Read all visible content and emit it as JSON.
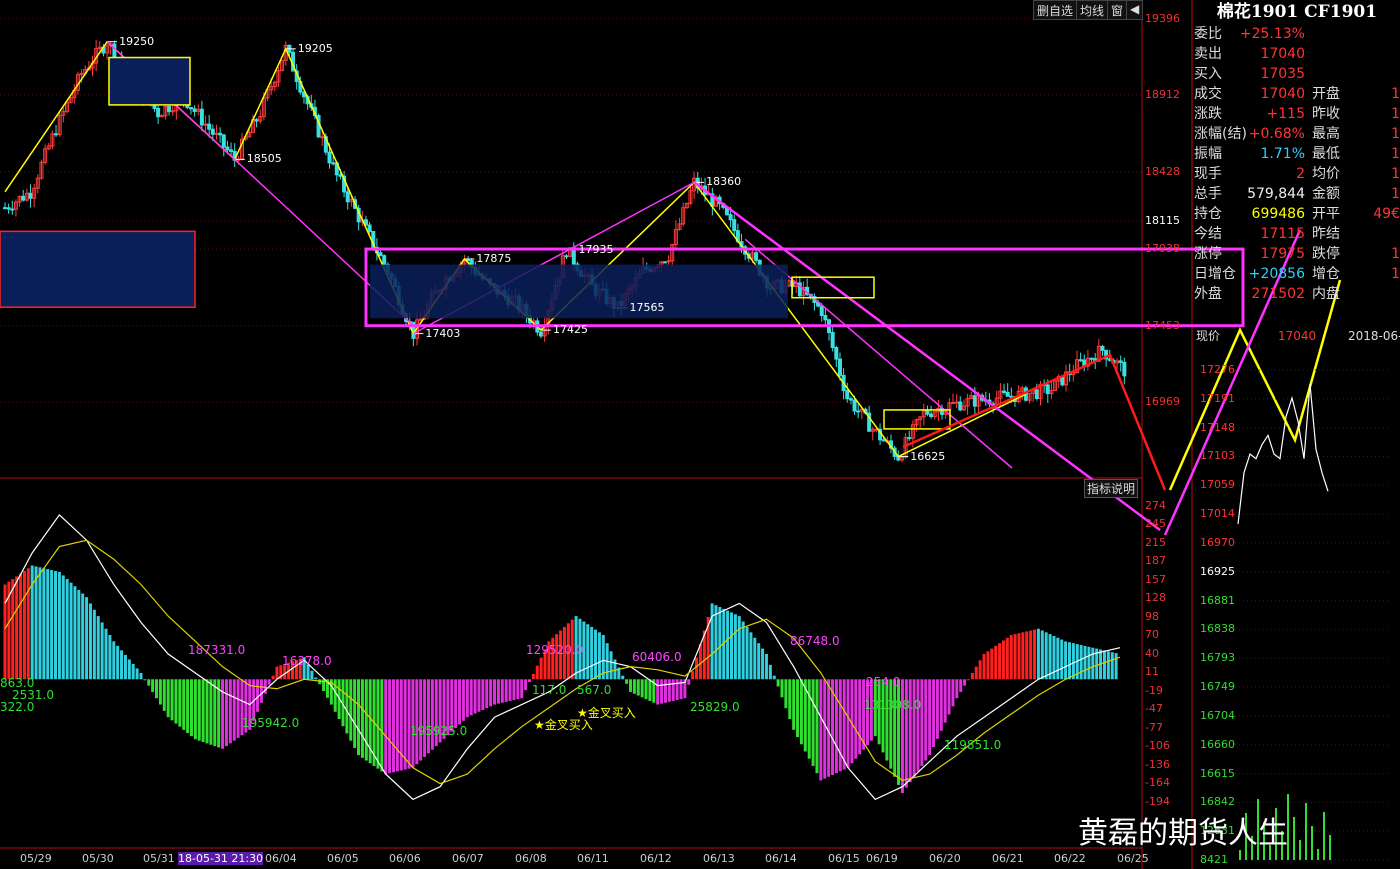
{
  "toolbar": {
    "items": [
      "删自选",
      "均线",
      "窗",
      "◀"
    ]
  },
  "quote": {
    "title": "棉花1901 CF1901",
    "rows": [
      {
        "label": "委比",
        "value": "+25.13%",
        "vcolor": "#ff3333"
      },
      {
        "label": "卖出",
        "value": "17040",
        "vcolor": "#ff3333"
      },
      {
        "label": "买入",
        "value": "17035",
        "vcolor": "#ff3333"
      },
      {
        "label": "成交",
        "value": "17040",
        "vcolor": "#ff3333",
        "label2": "开盘"
      },
      {
        "label": "涨跌",
        "value": "+115",
        "vcolor": "#ff3333",
        "label2": "昨收"
      },
      {
        "label": "涨幅(结)",
        "value": "+0.68%",
        "vcolor": "#ff3333",
        "label2": "最高"
      },
      {
        "label": "振幅",
        "value": "1.71%",
        "vcolor": "#33ccff",
        "label2": "最低"
      },
      {
        "label": "现手",
        "value": "2",
        "vcolor": "#ff3333",
        "label2": "均价"
      },
      {
        "label": "总手",
        "value": "579,844",
        "vcolor": "#eeeeee",
        "label2": "金额"
      },
      {
        "label": "持仓",
        "value": "699486",
        "vcolor": "#ffff00",
        "label2": "开平"
      },
      {
        "label": "今结",
        "value": "17115",
        "vcolor": "#ff3333",
        "label2": "昨结"
      },
      {
        "label": "涨停",
        "value": "17975",
        "vcolor": "#ff3333",
        "label2": "跌停"
      },
      {
        "label": "日增仓",
        "value": "+20856",
        "vcolor": "#33ccff",
        "label2": "增仓"
      },
      {
        "label": "外盘",
        "value": "271502",
        "vcolor": "#ff3333",
        "label2": "内盘"
      }
    ],
    "right_values": [
      "1",
      "1",
      "1",
      "1",
      "1",
      "1",
      "49€",
      "",
      "1",
      "1",
      "",
      "30"
    ],
    "price_label": "现价",
    "price_value": "17040",
    "date_value": "2018-06-2"
  },
  "hint_label": "指标说明",
  "watermark": "黄磊的期货人生",
  "chart_data": [
    {
      "type": "candlestick",
      "title": "",
      "y_ticks": [
        19396,
        18912,
        18428,
        18115,
        17938,
        17453,
        16969
      ],
      "ylim": [
        16540,
        19400
      ],
      "x_ticks": [
        "05/29",
        "05/30",
        "05/31",
        "18-05-31 21:30",
        "06/04",
        "06/05",
        "06/06",
        "06/07",
        "06/08",
        "06/11",
        "06/12",
        "06/13",
        "06/14",
        "06/15",
        "06/19",
        "06/20",
        "06/21",
        "06/22",
        "06/25"
      ],
      "annotations": [
        {
          "text": "19250",
          "value": 19250
        },
        {
          "text": "19205",
          "value": 19205
        },
        {
          "text": "18505",
          "value": 18505
        },
        {
          "text": "17875",
          "value": 17875
        },
        {
          "text": "17935",
          "value": 17935
        },
        {
          "text": "17565",
          "value": 17565
        },
        {
          "text": "17403",
          "value": 17403
        },
        {
          "text": "17425",
          "value": 17425
        },
        {
          "text": "18360",
          "value": 18360
        },
        {
          "text": "16625",
          "value": 16625
        }
      ],
      "price_path": [
        18200,
        18300,
        18700,
        19050,
        19250,
        19000,
        18800,
        18900,
        18700,
        18505,
        18800,
        19205,
        18800,
        18400,
        18100,
        17800,
        17403,
        17700,
        17875,
        17700,
        17600,
        17425,
        17935,
        17700,
        17565,
        17800,
        17900,
        18360,
        18200,
        17950,
        17700,
        17700,
        17550,
        17000,
        16800,
        16625,
        16900,
        16950,
        16980,
        17000,
        17020,
        17050,
        17200,
        17300,
        17150
      ]
    },
    {
      "type": "bar",
      "title": "",
      "y_ticks": [
        274,
        245,
        215,
        187,
        157,
        128,
        98,
        70,
        40,
        11,
        -19,
        -47,
        -77,
        -106,
        -136,
        -164,
        -194
      ],
      "ylim": [
        -210,
        290
      ],
      "labels": [
        "187331.0",
        "16378.0",
        "129520.0",
        "60406.0",
        "86748.0",
        "195942.0",
        "195925.0",
        "117.0",
        "567.0",
        "25829.0",
        "131308.0",
        "119851.0",
        "2531.0",
        "322.0",
        "863.0",
        "254.0"
      ],
      "annotation_signals": [
        "金叉买入",
        "金叉买入"
      ],
      "macd": [
        150,
        180,
        170,
        130,
        60,
        10,
        -60,
        -95,
        -110,
        -80,
        20,
        35,
        -40,
        -120,
        -150,
        -140,
        -100,
        -60,
        -40,
        -30,
        60,
        100,
        70,
        -20,
        -40,
        -30,
        120,
        100,
        40,
        -80,
        -160,
        -140,
        -90,
        -180,
        -120,
        -30,
        40,
        70,
        80,
        60,
        50,
        40
      ],
      "dif": [
        120,
        200,
        260,
        220,
        150,
        90,
        40,
        10,
        -20,
        -40,
        0,
        30,
        -10,
        -80,
        -150,
        -190,
        -170,
        -110,
        -60,
        -40,
        -20,
        10,
        30,
        20,
        -10,
        -5,
        100,
        120,
        90,
        20,
        -60,
        -140,
        -190,
        -170,
        -130,
        -90,
        -60,
        -30,
        0,
        20,
        40,
        50
      ],
      "dea": [
        80,
        150,
        210,
        220,
        190,
        150,
        100,
        60,
        20,
        -10,
        -15,
        0,
        -5,
        -40,
        -90,
        -140,
        -165,
        -150,
        -110,
        -75,
        -45,
        -15,
        10,
        20,
        15,
        5,
        40,
        80,
        95,
        65,
        10,
        -60,
        -130,
        -160,
        -150,
        -120,
        -85,
        -55,
        -25,
        0,
        20,
        35
      ]
    },
    {
      "type": "line",
      "title": "",
      "y_ticks": [
        17276,
        17191,
        17148,
        17103,
        17059,
        17014,
        16970,
        16925,
        16881,
        16838,
        16793,
        16749,
        16704,
        16660,
        16615,
        16842,
        12631,
        8421
      ],
      "values": [
        16970,
        17080,
        17120,
        17110,
        17140,
        17160,
        17120,
        17110,
        17200,
        17240,
        17190,
        17110,
        17270,
        17130,
        17080,
        17040
      ]
    }
  ]
}
